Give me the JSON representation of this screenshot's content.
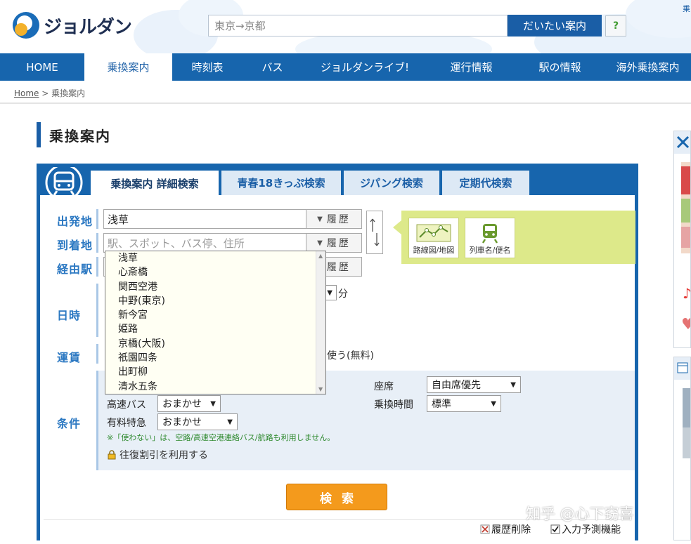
{
  "header": {
    "logo_text": "ジョルダン",
    "search_value": "東京→京都",
    "search_button": "だいたい案内",
    "help_label": "?",
    "top_right_text": "乗"
  },
  "nav": {
    "items": [
      {
        "label": "HOME",
        "active": false
      },
      {
        "label": "乗換案内",
        "active": true
      },
      {
        "label": "時刻表",
        "active": false
      },
      {
        "label": "バス",
        "active": false
      },
      {
        "label": "ジョルダンライブ!",
        "active": false
      },
      {
        "label": "運行情報",
        "active": false
      },
      {
        "label": "駅の情報",
        "active": false
      },
      {
        "label": "海外乗換案内",
        "active": false
      }
    ]
  },
  "breadcrumb": {
    "home": "Home",
    "separator": ">",
    "current": "乗換案内"
  },
  "page_title": "乗換案内",
  "tabs": [
    {
      "label": "乗換案内 詳細検索",
      "active": true
    },
    {
      "label": "青春18きっぷ検索",
      "active": false
    },
    {
      "label": "ジパング検索",
      "active": false
    },
    {
      "label": "定期代検索",
      "active": false
    }
  ],
  "form": {
    "departure_label": "出発地",
    "departure_value": "浅草",
    "arrival_label": "到着地",
    "arrival_placeholder": "駅、スポット、バス停、住所",
    "via_label": "経由駅",
    "history_button": "履歴",
    "history_arrow": "▼",
    "datetime_label": "日時",
    "minute_unit": "分",
    "fare_label": "運賃",
    "fare_free_text": "使う(無料)",
    "conditions_label": "条件",
    "seat_label": "座席",
    "seat_value": "自由席優先",
    "highway_bus_label": "高速バス",
    "highway_bus_value": "おまかせ",
    "transfer_time_label": "乗換時間",
    "transfer_time_value": "標準",
    "limited_express_label": "有料特急",
    "limited_express_value": "おまかせ",
    "note": "※「使わない」は、空路/高速空港連絡バス/航路も利用しません。",
    "roundtrip_text": "往復割引を利用する",
    "search_button": "検索",
    "delete_history": "履歴削除",
    "predictive_input": "入力予測機能"
  },
  "tools": {
    "route_map": "路線図/地図",
    "train_name": "列車名/便名"
  },
  "dropdown_items": [
    "浅草",
    "心斎橋",
    "関西空港",
    "中野(東京)",
    "新今宮",
    "姫路",
    "京橋(大阪)",
    "祇園四条",
    "出町柳",
    "清水五条"
  ],
  "watermark": "知乎 @心下窃喜",
  "colors": {
    "brand_blue": "#1765ad",
    "label_blue": "#2b78c2",
    "search_orange": "#f49a1c",
    "tools_green": "#dde98a",
    "note_green": "#2f8a2f"
  }
}
